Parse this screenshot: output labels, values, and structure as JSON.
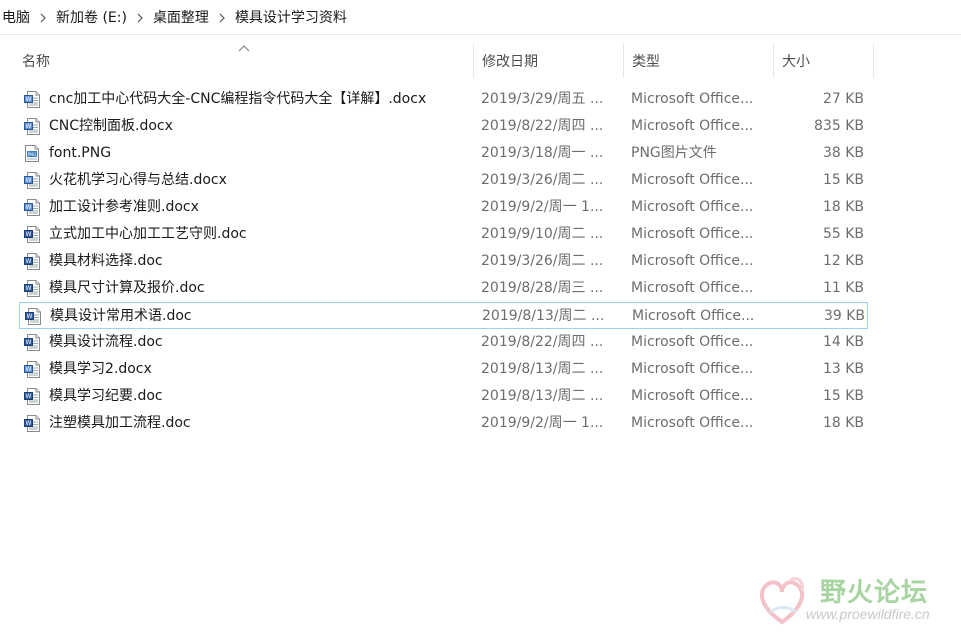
{
  "breadcrumb": {
    "items": [
      "电脑",
      "新加卷 (E:)",
      "桌面整理",
      "模具设计学习资料"
    ]
  },
  "columns": {
    "name": "名称",
    "date": "修改日期",
    "type": "类型",
    "size": "大小"
  },
  "files": [
    {
      "name": "cnc加工中心代码大全-CNC编程指令代码大全【详解】.docx",
      "date": "2019/3/29/周五 ...",
      "type": "Microsoft Office...",
      "size": "27 KB",
      "icon": "docx-icon"
    },
    {
      "name": "CNC控制面板.docx",
      "date": "2019/8/22/周四 ...",
      "type": "Microsoft Office...",
      "size": "835 KB",
      "icon": "docx-icon"
    },
    {
      "name": "font.PNG",
      "date": "2019/3/18/周一 ...",
      "type": "PNG图片文件",
      "size": "38 KB",
      "icon": "png-icon"
    },
    {
      "name": "火花机学习心得与总结.docx",
      "date": "2019/3/26/周二 ...",
      "type": "Microsoft Office...",
      "size": "15 KB",
      "icon": "docx-icon"
    },
    {
      "name": "加工设计参考准则.docx",
      "date": "2019/9/2/周一 1...",
      "type": "Microsoft Office...",
      "size": "18 KB",
      "icon": "docx-icon"
    },
    {
      "name": "立式加工中心加工工艺守则.doc",
      "date": "2019/9/10/周二 ...",
      "type": "Microsoft Office...",
      "size": "55 KB",
      "icon": "doc-icon"
    },
    {
      "name": "模具材料选择.doc",
      "date": "2019/3/26/周二 ...",
      "type": "Microsoft Office...",
      "size": "12 KB",
      "icon": "doc-icon"
    },
    {
      "name": "模具尺寸计算及报价.doc",
      "date": "2019/8/28/周三 ...",
      "type": "Microsoft Office...",
      "size": "11 KB",
      "icon": "doc-icon"
    },
    {
      "name": "模具设计常用术语.doc",
      "date": "2019/8/13/周二 ...",
      "type": "Microsoft Office...",
      "size": "39 KB",
      "icon": "doc-icon",
      "selected": true
    },
    {
      "name": "模具设计流程.doc",
      "date": "2019/8/22/周四 ...",
      "type": "Microsoft Office...",
      "size": "14 KB",
      "icon": "doc-icon"
    },
    {
      "name": "模具学习2.docx",
      "date": "2019/8/13/周二 ...",
      "type": "Microsoft Office...",
      "size": "13 KB",
      "icon": "docx-icon"
    },
    {
      "name": "模具学习纪要.doc",
      "date": "2019/8/13/周二 ...",
      "type": "Microsoft Office...",
      "size": "15 KB",
      "icon": "doc-icon"
    },
    {
      "name": "注塑模具加工流程.doc",
      "date": "2019/9/2/周一 1...",
      "type": "Microsoft Office...",
      "size": "18 KB",
      "icon": "doc-icon"
    }
  ],
  "watermark": {
    "title": "野火论坛",
    "url": "www.proewildfire.cn"
  },
  "colors": {
    "selection_border": "#99d1ff",
    "secondary_text": "#6d6d6d",
    "header_text": "#4d4d4d"
  }
}
